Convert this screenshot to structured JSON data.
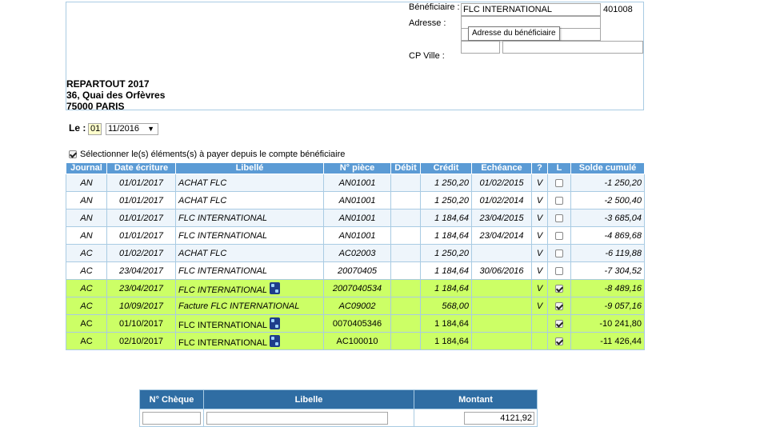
{
  "recipient": {
    "company": "REPARTOUT 2017",
    "street": "36, Quai des Orfèvres",
    "city": "75000 PARIS"
  },
  "beneficiary": {
    "label": "Bénéficiaire :",
    "name": "FLC INTERNATIONAL",
    "code": "401008",
    "address_label": "Adresse :",
    "address_tooltip": "Adresse du bénéficiaire",
    "cp_ville_label": "CP Ville :"
  },
  "date": {
    "label": "Le :",
    "day": "01",
    "month": "11/2016"
  },
  "select_option": {
    "label": "Sélectionner le(s) éléments(s) à payer depuis le compte bénéficiaire",
    "checked": true
  },
  "ledger": {
    "headers": [
      "Journal",
      "Date écriture",
      "Libellé",
      "N° pièce",
      "Débit",
      "Crédit",
      "Echéance",
      "?",
      "L",
      "Solde cumulé"
    ],
    "rows": [
      {
        "journal": "AN",
        "date": "01/01/2017",
        "libelle": "ACHAT FLC",
        "piece": "AN01001",
        "debit": "",
        "credit": "1 250,20",
        "echeance": "01/02/2015",
        "q": "V",
        "checked": false,
        "solde": "-1 250,20"
      },
      {
        "journal": "AN",
        "date": "01/01/2017",
        "libelle": "ACHAT FLC",
        "piece": "AN01001",
        "debit": "",
        "credit": "1 250,20",
        "echeance": "01/02/2014",
        "q": "V",
        "checked": false,
        "solde": "-2 500,40"
      },
      {
        "journal": "AN",
        "date": "01/01/2017",
        "libelle": "FLC INTERNATIONAL",
        "piece": "AN01001",
        "debit": "",
        "credit": "1 184,64",
        "echeance": "23/04/2015",
        "q": "V",
        "checked": false,
        "solde": "-3 685,04"
      },
      {
        "journal": "AN",
        "date": "01/01/2017",
        "libelle": "FLC INTERNATIONAL",
        "piece": "AN01001",
        "debit": "",
        "credit": "1 184,64",
        "echeance": "23/04/2014",
        "q": "V",
        "checked": false,
        "solde": "-4 869,68"
      },
      {
        "journal": "AC",
        "date": "01/02/2017",
        "libelle": "ACHAT FLC",
        "piece": "AC02003",
        "debit": "",
        "credit": "1 250,20",
        "echeance": "",
        "q": "V",
        "checked": false,
        "solde": "-6 119,88"
      },
      {
        "journal": "AC",
        "date": "23/04/2017",
        "libelle": "FLC INTERNATIONAL",
        "piece": "20070405",
        "debit": "",
        "credit": "1 184,64",
        "echeance": "30/06/2016",
        "q": "V",
        "checked": false,
        "solde": "-7 304,52"
      },
      {
        "journal": "AC",
        "date": "23/04/2017",
        "libelle": "FLC INTERNATIONAL",
        "piece": "2007040534",
        "debit": "",
        "credit": "1 184,64",
        "echeance": "",
        "q": "V",
        "checked": true,
        "solde": "-8 489,16"
      },
      {
        "journal": "AC",
        "date": "10/09/2017",
        "libelle": "Facture FLC INTERNATIONAL",
        "piece": "AC09002",
        "debit": "",
        "credit": "568,00",
        "echeance": "",
        "q": "V",
        "checked": true,
        "solde": "-9 057,16"
      },
      {
        "journal": "AC",
        "date": "01/10/2017",
        "libelle": "FLC INTERNATIONAL",
        "piece": "0070405346",
        "debit": "",
        "credit": "1 184,64",
        "echeance": "",
        "q": "",
        "checked": true,
        "solde": "-10 241,80"
      },
      {
        "journal": "AC",
        "date": "02/10/2017",
        "libelle": "FLC INTERNATIONAL",
        "piece": "AC100010",
        "debit": "",
        "credit": "1 184,64",
        "echeance": "",
        "q": "",
        "checked": true,
        "solde": "-11 426,44"
      }
    ]
  },
  "cheque": {
    "headers": [
      "N° Chèque",
      "Libelle",
      "Montant"
    ],
    "numero": "",
    "libelle": "",
    "montant": "4121,92"
  },
  "colors": {
    "header_blue": "#5b9bd5",
    "header_dark_blue": "#2f6da3",
    "selected_row": "#ccff66",
    "border": "#a9cbe3"
  }
}
